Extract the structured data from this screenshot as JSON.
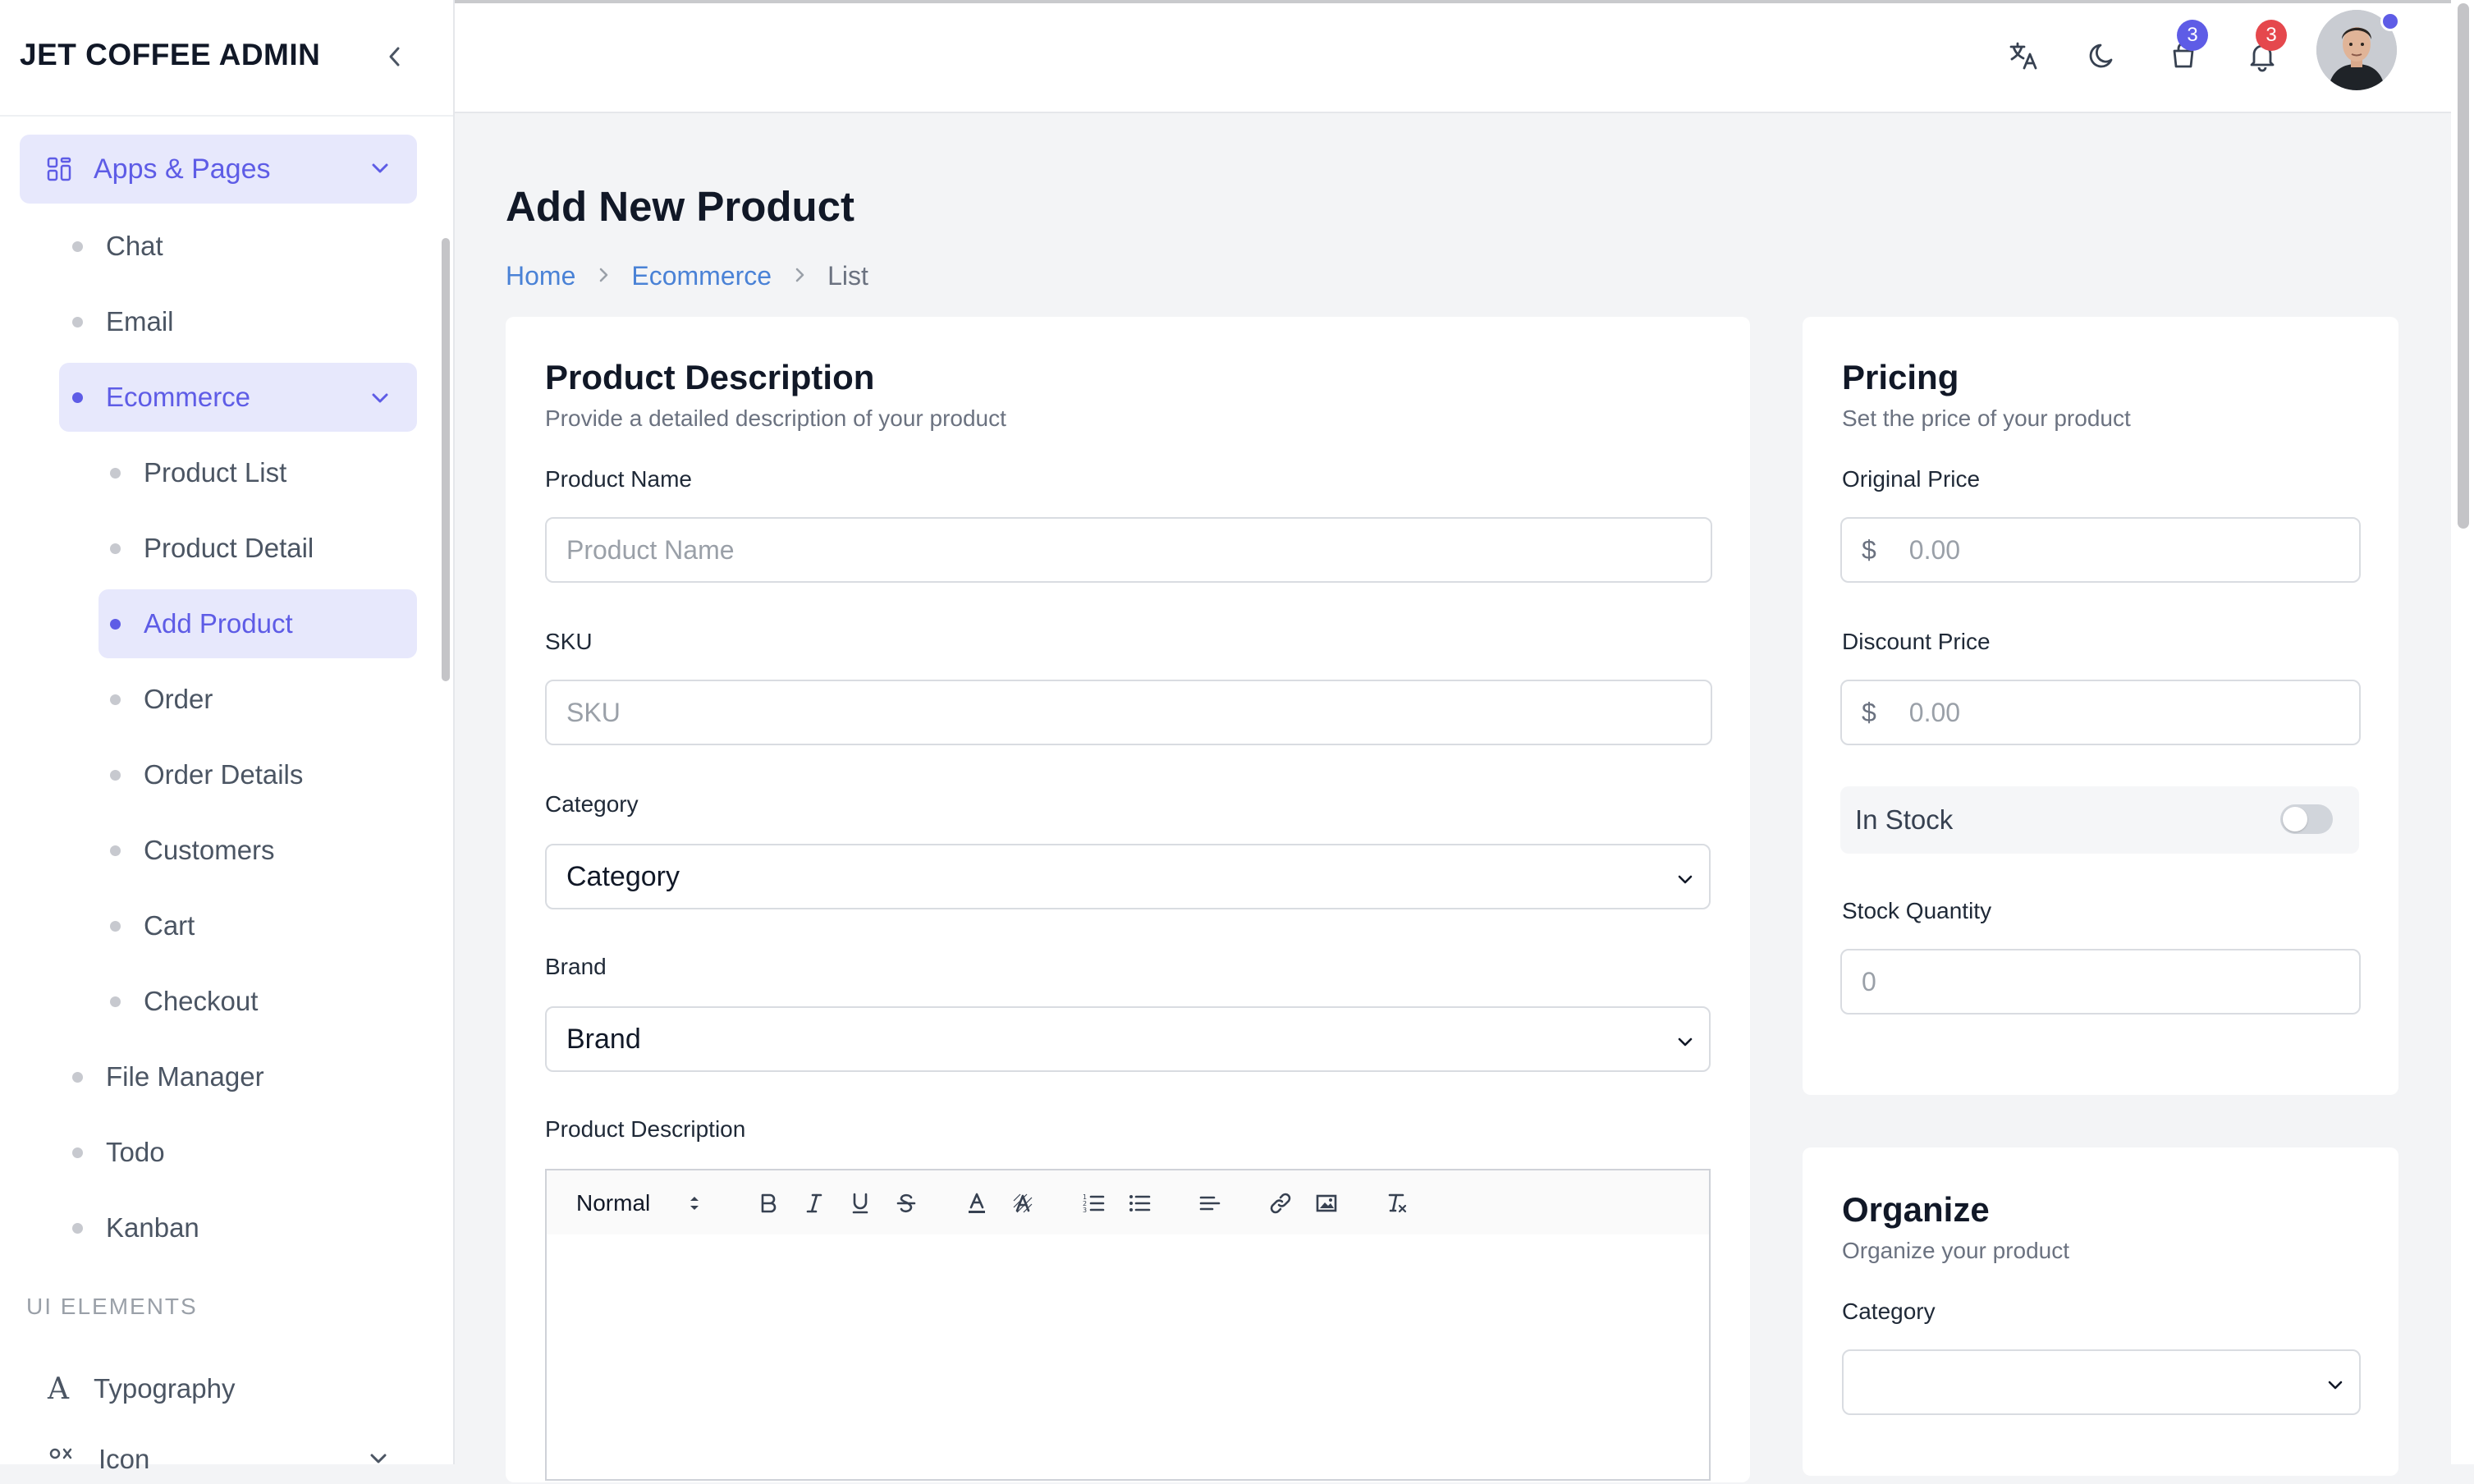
{
  "app": {
    "title": "JET COFFEE ADMIN"
  },
  "sidebar": {
    "group": {
      "label": "Apps & Pages"
    },
    "items": [
      {
        "label": "Chat"
      },
      {
        "label": "Email"
      },
      {
        "label": "Ecommerce"
      },
      {
        "label": "Product List"
      },
      {
        "label": "Product Detail"
      },
      {
        "label": "Add Product"
      },
      {
        "label": "Order"
      },
      {
        "label": "Order Details"
      },
      {
        "label": "Customers"
      },
      {
        "label": "Cart"
      },
      {
        "label": "Checkout"
      },
      {
        "label": "File Manager"
      },
      {
        "label": "Todo"
      },
      {
        "label": "Kanban"
      }
    ],
    "section_label": "UI ELEMENTS",
    "typography": {
      "label": "Typography",
      "glyph": "A"
    },
    "icon_item": {
      "label": "Icon"
    }
  },
  "header": {
    "cart_count": "3",
    "notification_count": "3",
    "icons": [
      "translate-icon",
      "moon-icon",
      "cart-icon",
      "bell-icon"
    ]
  },
  "page": {
    "title": "Add New Product",
    "breadcrumb": [
      "Home",
      "Ecommerce",
      "List"
    ]
  },
  "product_description": {
    "title": "Product Description",
    "subtitle": "Provide a detailed description of your product",
    "name_label": "Product Name",
    "name_placeholder": "Product Name",
    "sku_label": "SKU",
    "sku_placeholder": "SKU",
    "category_label": "Category",
    "category_value": "Category",
    "brand_label": "Brand",
    "brand_value": "Brand",
    "description_label": "Product Description",
    "editor_format": "Normal"
  },
  "pricing": {
    "title": "Pricing",
    "subtitle": "Set the price of your product",
    "original_label": "Original Price",
    "original_placeholder": "0.00",
    "discount_label": "Discount Price",
    "discount_placeholder": "0.00",
    "currency": "$",
    "in_stock_label": "In Stock",
    "in_stock": false,
    "stock_label": "Stock Quantity",
    "stock_placeholder": "0"
  },
  "organize": {
    "title": "Organize",
    "subtitle": "Organize your product",
    "category_label": "Category",
    "category_value": ""
  },
  "colors": {
    "accent": "#5e5ce6",
    "badge_cart": "#5e5ce6",
    "badge_bell": "#e5484d",
    "link": "#4a82d6"
  }
}
